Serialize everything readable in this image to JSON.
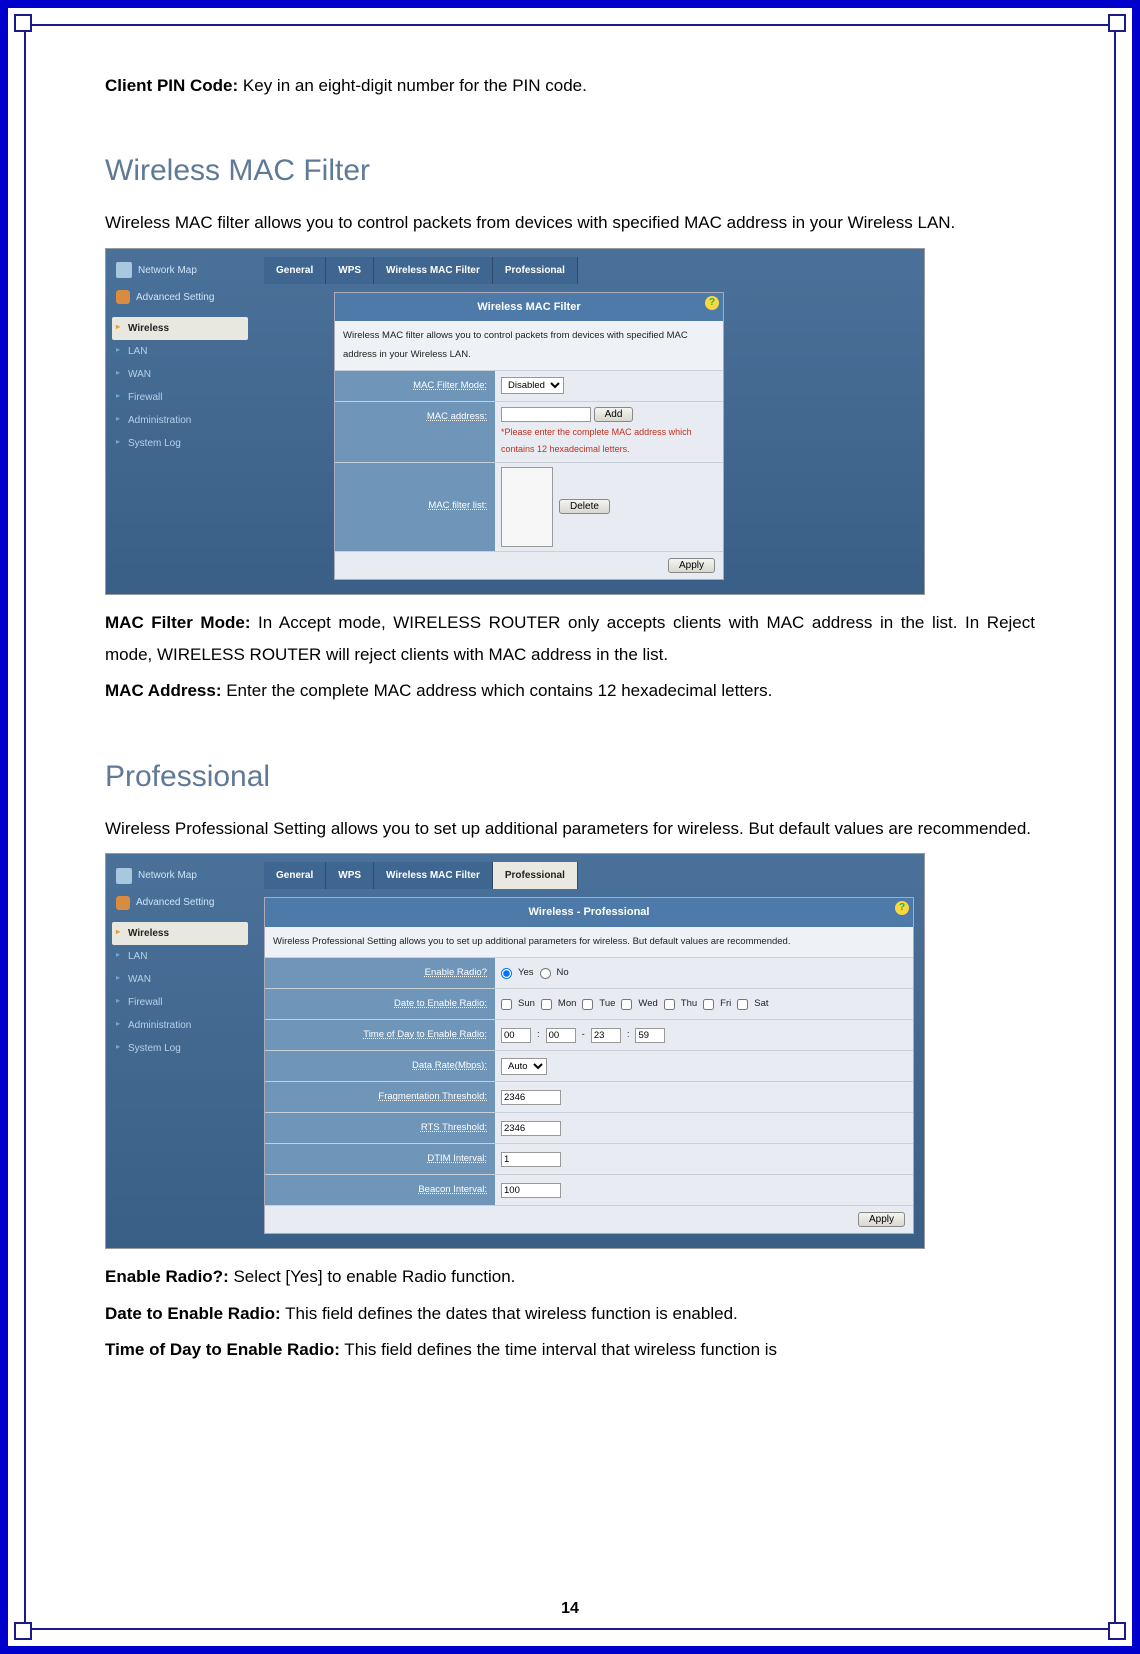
{
  "intro": {
    "clientPin": {
      "label": "Client PIN Code:",
      "text": " Key in an eight-digit number for the PIN code."
    }
  },
  "macFilterSection": {
    "heading": "Wireless MAC Filter",
    "intro": "Wireless MAC filter allows you to control packets from devices with specified MAC address in your Wireless LAN.",
    "mode": {
      "label": "MAC Filter Mode:",
      "text": " In Accept mode, WIRELESS ROUTER only accepts clients with MAC address in the list. In Reject mode, WIRELESS ROUTER will reject clients with MAC address in the list."
    },
    "addr": {
      "label": "MAC Address:",
      "text": " Enter the complete MAC address which contains 12 hexadecimal letters."
    }
  },
  "professionalSection": {
    "heading": "Professional",
    "intro": "Wireless Professional Setting allows you to set up additional parameters for wireless. But default values are recommended.",
    "enable": {
      "label": "Enable Radio?:",
      "text": " Select [Yes] to enable Radio function."
    },
    "date": {
      "label": "Date to Enable Radio:",
      "text": " This field defines the dates that wireless function is enabled."
    },
    "time": {
      "label": "Time of Day to Enable Radio:",
      "text": " This field defines the time interval that wireless function is"
    }
  },
  "sidebar": {
    "networkMap": "Network Map",
    "advanced": "Advanced Setting",
    "items": [
      "Wireless",
      "LAN",
      "WAN",
      "Firewall",
      "Administration",
      "System Log"
    ]
  },
  "tabs": {
    "general": "General",
    "wps": "WPS",
    "macFilter": "Wireless MAC Filter",
    "professional": "Professional"
  },
  "panel1": {
    "title": "Wireless MAC Filter",
    "desc": "Wireless MAC filter allows you to control packets from devices with specified MAC address in your Wireless LAN.",
    "rowMode": "MAC Filter Mode:",
    "modeValue": "Disabled",
    "rowAddr": "MAC address:",
    "addrWarn": "*Please enter the complete MAC address which contains 12 hexadecimal letters.",
    "addBtn": "Add",
    "rowList": "MAC filter list:",
    "deleteBtn": "Delete",
    "apply": "Apply"
  },
  "panel2": {
    "title": "Wireless - Professional",
    "desc": "Wireless Professional Setting allows you to set up additional parameters for wireless. But default values are recommended.",
    "enableRadio": "Enable Radio?",
    "yes": "Yes",
    "no": "No",
    "dateEnable": "Date to Enable Radio:",
    "days": [
      "Sun",
      "Mon",
      "Tue",
      "Wed",
      "Thu",
      "Fri",
      "Sat"
    ],
    "timeEnable": "Time of Day to Enable Radio:",
    "t1": "00",
    "t2": "00",
    "t3": "23",
    "t4": "59",
    "dataRate": "Data Rate(Mbps):",
    "dataRateVal": "Auto",
    "frag": "Fragmentation Threshold:",
    "fragVal": "2346",
    "rts": "RTS Threshold:",
    "rtsVal": "2346",
    "dtim": "DTIM Interval:",
    "dtimVal": "1",
    "beacon": "Beacon Interval:",
    "beaconVal": "100",
    "apply": "Apply"
  },
  "pageNumber": "14"
}
